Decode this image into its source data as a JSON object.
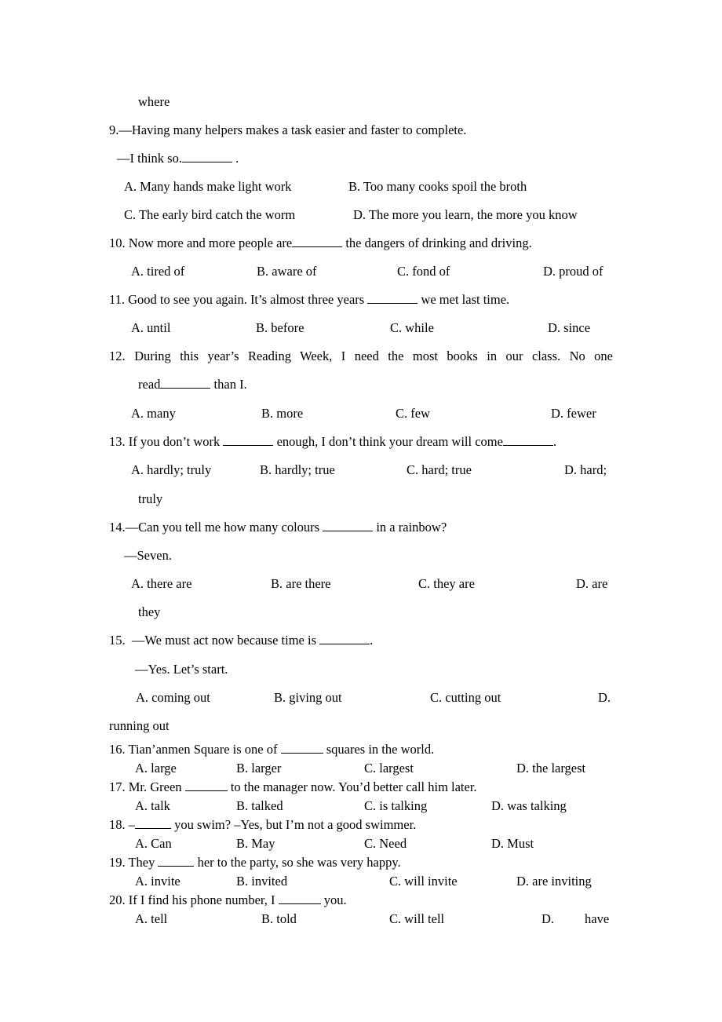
{
  "document": {
    "carryover": "where",
    "questions": [
      {
        "number": "9.",
        "stem": "—Having many helpers makes a task easier and faster to complete.",
        "reply_prefix": "—I think so.",
        "reply_suffix": " .",
        "options": {
          "A": "A. Many hands make light work",
          "B": "B. Too many cooks spoil the broth",
          "C": "C. The early bird catch the worm",
          "D": "D. The more you learn, the more you know"
        }
      },
      {
        "number": "10.",
        "stem_before": "Now more and more people are",
        "stem_after": " the dangers of drinking and driving.",
        "options": {
          "A": "A. tired of",
          "B": "B. aware of",
          "C": "C. fond of",
          "D": "D. proud of"
        }
      },
      {
        "number": "11.",
        "stem_before": "Good to see you again. It’s almost three years ",
        "stem_after": " we met last time.",
        "options": {
          "A": "A. until",
          "B": "B. before",
          "C": "C. while",
          "D": "D. since"
        }
      },
      {
        "number": "12.",
        "stem_line1": "During this year’s Reading Week, I need the most books in our class. No one",
        "stem_line2_before": "read",
        "stem_line2_after": " than I.",
        "options": {
          "A": "A. many",
          "B": "B. more",
          "C": "C. few",
          "D": "D. fewer"
        }
      },
      {
        "number": "13.",
        "stem_before": "If you don’t work ",
        "stem_middle": " enough, I don’t think your dream will come",
        "stem_after": ".",
        "options": {
          "A": "A. hardly; truly",
          "B": "B. hardly; true",
          "C": "C. hard; true",
          "D": "D. hard;",
          "D_wrap": "truly"
        }
      },
      {
        "number": "14.",
        "stem_before": "—Can you tell me how many colours ",
        "stem_after": " in a rainbow?",
        "reply": "—Seven.",
        "options": {
          "A": "A. there are",
          "B": "B. are there",
          "C": "C. they are",
          "D": "D. are",
          "D_wrap": "they"
        }
      },
      {
        "number": "15.",
        "stem_before": "—We must act now because time is ",
        "stem_after": ".",
        "reply": "—Yes. Let’s start.",
        "options": {
          "A": "A. coming out",
          "B": "B. giving out",
          "C": "C. cutting out",
          "D": "D.",
          "D_wrap": "running out"
        }
      },
      {
        "number": "16.",
        "stem_before": "Tian’anmen Square is one of ",
        "stem_after": " squares in the world.",
        "options": {
          "A": "A. large",
          "B": "B. larger",
          "C": "C. largest",
          "D": "D. the largest"
        }
      },
      {
        "number": "17.",
        "stem_before": "Mr. Green ",
        "stem_after": " to the manager now. You’d better call him later.",
        "options": {
          "A": "A. talk",
          "B": "B. talked",
          "C": "C. is talking",
          "D": "D. was talking"
        }
      },
      {
        "number": "18.",
        "stem_before": "–",
        "stem_after": " you swim? –Yes, but I’m not a good swimmer.",
        "options": {
          "A": "A. Can",
          "B": "B. May",
          "C": "C. Need",
          "D": "D. Must"
        }
      },
      {
        "number": "19.",
        "stem_before": "They ",
        "stem_after": " her to the party, so she was very happy.",
        "options": {
          "A": "A. invite",
          "B": "B. invited",
          "C": "C. will invite",
          "D": "D. are inviting"
        }
      },
      {
        "number": "20.",
        "stem_before": "If I find his phone number, I ",
        "stem_after": " you.",
        "options": {
          "A": "A. tell",
          "B": "B. told",
          "C": "C. will tell",
          "D": "D.",
          "D_tail": "have"
        }
      }
    ]
  }
}
